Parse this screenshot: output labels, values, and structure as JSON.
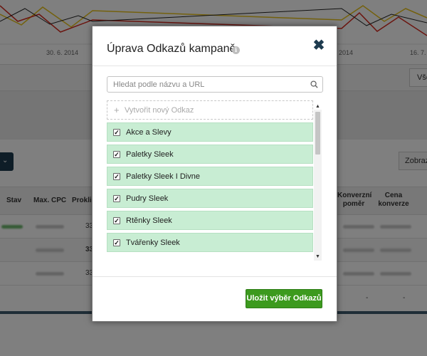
{
  "background": {
    "chart_dates": [
      "30. 6. 2014",
      "2014",
      "16. 7."
    ],
    "all_button_label": "Vše",
    "show_button_label": "Zobraz",
    "dark_button_icon": "chevron-down-icon",
    "table_headers": {
      "status": "Stav",
      "max_cpc": "Max. CPC",
      "clicks": "Proklik",
      "conversion_rate": "Konverzní poměr",
      "conversion_price": "Cena konverze"
    },
    "row_values": [
      "33",
      "33",
      "33"
    ],
    "dash": "-"
  },
  "modal": {
    "title": "Úprava Odkazů kampaně",
    "info_icon": "info-icon",
    "close_icon": "close-icon",
    "search": {
      "value": "",
      "placeholder": "Hledat podle názvu a URL"
    },
    "new_item_label": "Vytvořit nový Odkaz",
    "items": [
      {
        "label": "Akce a Slevy",
        "checked": true
      },
      {
        "label": "Paletky Sleek",
        "checked": true
      },
      {
        "label": "Paletky Sleek I Divne",
        "checked": true
      },
      {
        "label": "Pudry Sleek",
        "checked": true
      },
      {
        "label": "Rtěnky Sleek",
        "checked": true
      },
      {
        "label": "Tvářenky Sleek",
        "checked": true
      }
    ],
    "save_label": "Uložit výběr Odkazů"
  },
  "colors": {
    "selected_item_bg": "#c8edd3",
    "save_button": "#3c9a1e",
    "close_icon": "#1d3b4f"
  }
}
